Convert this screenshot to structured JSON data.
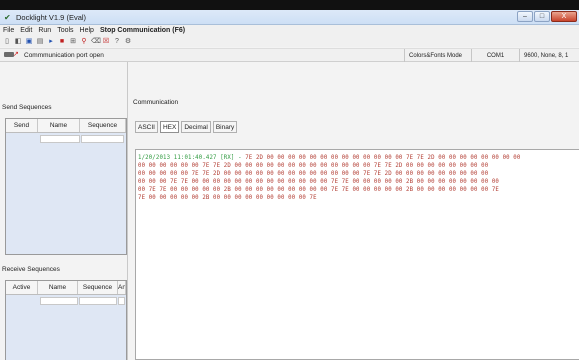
{
  "window": {
    "title": "Docklight V1.9 (Eval)",
    "minimize": "–",
    "maximize": "□",
    "close": "X"
  },
  "menu": [
    "File",
    "Edit",
    "Run",
    "Tools",
    "Help",
    "Stop Communication  (F6)"
  ],
  "toolbar_icons": [
    "new-file-icon",
    "open-icon",
    "save-icon",
    "print-icon",
    "play-icon",
    "stop-icon",
    "settings-icon",
    "search-icon",
    "clear-icon",
    "help-icon",
    "options-icon",
    "print-preview-icon"
  ],
  "status": {
    "port_message": "Commmunication port open",
    "colors_fonts": "Colors&Fonts Mode",
    "com_port": "COM1",
    "settings": "9600, None, 8, 1"
  },
  "send_sequences": {
    "label": "Send Sequences",
    "columns": [
      "Send",
      "Name",
      "Sequence"
    ]
  },
  "receive_sequences": {
    "label": "Receive Sequences",
    "columns": [
      "Active",
      "Name",
      "Sequence",
      "Answ"
    ]
  },
  "communication": {
    "label": "Communication",
    "tabs": [
      "ASCII",
      "HEX",
      "Decimal",
      "Binary"
    ],
    "active_tab": "HEX",
    "log": {
      "timestamp": "1/20/2013 11:01:40.427 [RX] - ",
      "lines": [
        "7E 2D 00 00 00 00 00 00 00 00 00 00 00 00 00 7E 7E 2D 00 00 00 00 00 00 00 00",
        "00 00 00 00 00 00 7E 7E 2D 00 00 00 00 00 00 00 00 00 00 00 00 00 7E 7E 2D 00 00 00 00 00 00 00 00",
        "00 00 00 00 00 7E 7E 2D 00 00 00 00 00 00 00 00 00 00 00 00 00 7E 7E 2D 00 00 00 00 00 00 00 00 00",
        "00 00 00 7E 7E 00 00 00 00 00 00 00 00 00 00 00 00 00 7E 7E 00 00 00 00 00 2B 00 00 00 00 00 00 00 00",
        "00 7E 7E 00 00 00 00 00 2B 00 00 00 00 00 00 00 00 00 7E 7E 00 00 00 00 00 2B 00 00 00 00 00 00 00 7E",
        "7E 00 00 00 00 00 2B 00 00 00 00 00 00 00 00 00 7E"
      ]
    }
  }
}
